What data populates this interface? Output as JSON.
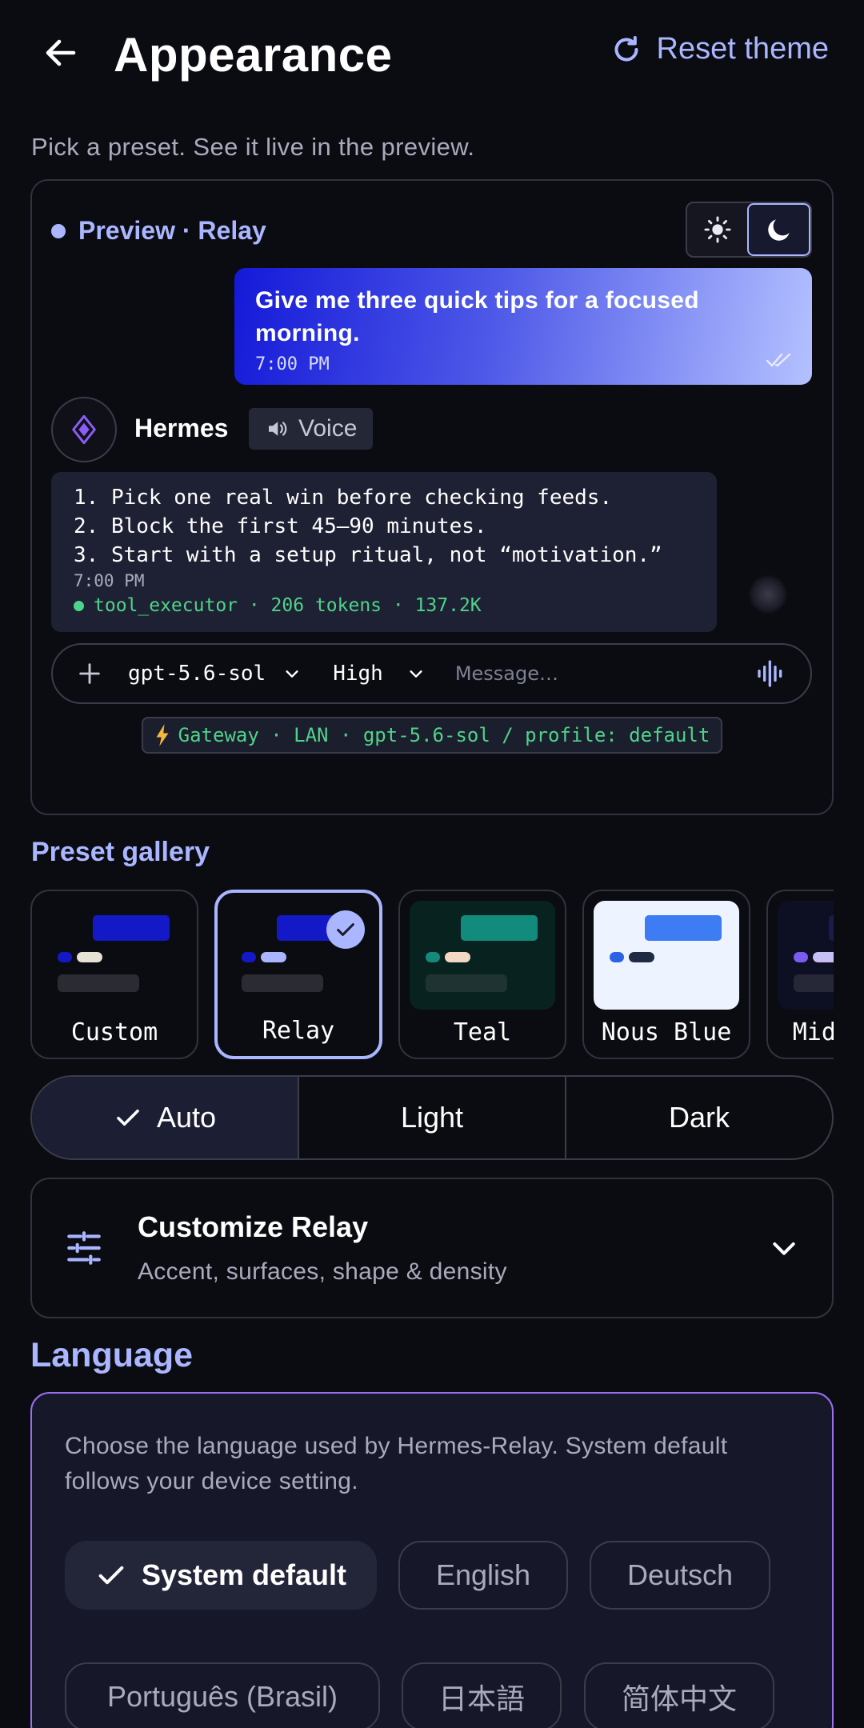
{
  "header": {
    "title": "Appearance",
    "reset_label": "Reset theme",
    "subtitle": "Pick a preset. See it live in the preview."
  },
  "preview": {
    "label": "Preview · Relay",
    "user_message": "Give me three quick tips for a focused morning.",
    "user_time": "7:00 PM",
    "bot_name": "Hermes",
    "voice_label": "Voice",
    "bot_lines": [
      "1. Pick one real win before checking feeds.",
      "2. Block the first 45–90 minutes.",
      "3. Start with a setup ritual, not “motivation.”"
    ],
    "bot_time": "7:00 PM",
    "bot_meta": "tool_executor · 206 tokens · 137.2K",
    "composer": {
      "model": "gpt-5.6-sol",
      "effort": "High",
      "placeholder": "Message…"
    },
    "gateway": "Gateway · LAN · gpt-5.6-sol / profile: default"
  },
  "gallery": {
    "title": "Preset gallery",
    "presets": [
      {
        "name": "Custom",
        "bg": "#0b0c12",
        "top": "#1419c8",
        "dot": "#1419c8",
        "pill": "#e8e2d6",
        "bot": "#2a2b33",
        "selected": false
      },
      {
        "name": "Relay",
        "bg": "#0b0c12",
        "top": "#1419c8",
        "dot": "#1419c8",
        "pill": "#aab6ff",
        "bot": "#2a2b33",
        "selected": true
      },
      {
        "name": "Teal",
        "bg": "#082220",
        "top": "#128a7c",
        "dot": "#128a7c",
        "pill": "#f3d9c4",
        "bot": "#1f3432",
        "selected": false
      },
      {
        "name": "Nous Blue",
        "bg": "#eef4ff",
        "top": "#3d7cf2",
        "dot": "#2a62e6",
        "pill": "#1f2b45",
        "bot": "#eef4ff",
        "selected": false
      },
      {
        "name": "Midnight",
        "bg": "#0d0f22",
        "top": "#1a1c4a",
        "dot": "#7b5cf0",
        "pill": "#c9bff7",
        "bot": "#262838",
        "selected": false
      }
    ]
  },
  "mode": {
    "options": [
      "Auto",
      "Light",
      "Dark"
    ],
    "selected": "Auto"
  },
  "customize": {
    "title": "Customize Relay",
    "subtitle": "Accent, surfaces, shape & density"
  },
  "language": {
    "title": "Language",
    "description": "Choose the language used by Hermes-Relay. System default follows your device setting.",
    "options": [
      "System default",
      "English",
      "Deutsch",
      "Português (Brasil)",
      "日本語",
      "简体中文"
    ],
    "selected": "System default"
  },
  "colors": {
    "accent": "#aab6ff",
    "background": "#0b0c12",
    "success": "#4fd38a",
    "language_border": "#9b6ff0"
  }
}
